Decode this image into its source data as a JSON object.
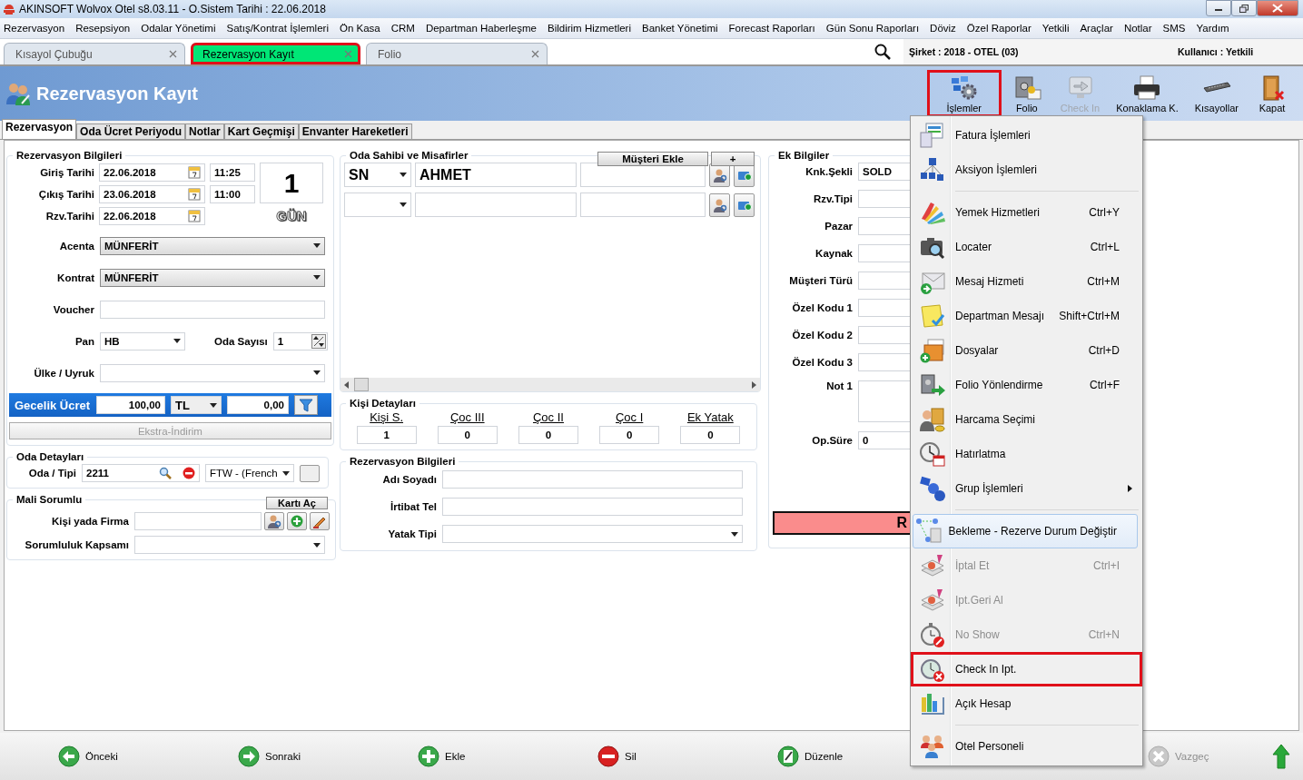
{
  "window": {
    "title": "AKINSOFT Wolvox Otel s8.03.11 - O.Sistem Tarihi : 22.06.2018"
  },
  "menu_bar": [
    "Rezervasyon",
    "Resepsiyon",
    "Odalar Yönetimi",
    "Satış/Kontrat İşlemleri",
    "Ön Kasa",
    "CRM",
    "Departman Haberleşme",
    "Bildirim Hizmetleri",
    "Banket Yönetimi",
    "Forecast Raporları",
    "Gün Sonu Raporları",
    "Döviz",
    "Özel Raporlar",
    "Yetkili",
    "Araçlar",
    "Notlar",
    "SMS",
    "Yardım"
  ],
  "doc_tabs": [
    {
      "label": "Kısayol Çubuğu",
      "selected": false,
      "outlined": false
    },
    {
      "label": "Rezervasyon Kayıt",
      "selected": true,
      "outlined": true
    },
    {
      "label": "Folio",
      "selected": false,
      "outlined": false
    }
  ],
  "company": "Şirket : 2018 - OTEL (03)",
  "user": "Kullanıcı : Yetkili",
  "header": {
    "title": "Rezervasyon Kayıt"
  },
  "toolbar": [
    {
      "label": "İşlemler",
      "disabled": false,
      "outlined": true
    },
    {
      "label": "Folio",
      "disabled": false,
      "outlined": false
    },
    {
      "label": "Check In",
      "disabled": true,
      "outlined": false
    },
    {
      "label": "Konaklama K.",
      "disabled": false,
      "outlined": false
    },
    {
      "label": "Kısayollar",
      "disabled": false,
      "outlined": false
    },
    {
      "label": "Kapat",
      "disabled": false,
      "outlined": false
    }
  ],
  "form_tabs": [
    {
      "label": "Rezervasyon",
      "selected": true
    },
    {
      "label": "Oda Ücret Periyodu",
      "selected": false
    },
    {
      "label": "Notlar",
      "selected": false
    },
    {
      "label": "Kart Geçmişi",
      "selected": false
    },
    {
      "label": "Envanter Hareketleri",
      "selected": false
    }
  ],
  "reservation": {
    "title": "Rezervasyon Bilgileri",
    "dates": [
      {
        "label": "Giriş Tarihi",
        "date": "22.06.2018",
        "time": "11:25"
      },
      {
        "label": "Çıkış Tarihi",
        "date": "23.06.2018",
        "time": "11:00"
      },
      {
        "label": "Rzv.Tarihi",
        "date": "22.06.2018"
      }
    ],
    "nights": "1",
    "nights_unit": "GÜN",
    "agency": {
      "label": "Acenta",
      "value": "MÜNFERİT"
    },
    "contract": {
      "label": "Kontrat",
      "value": "MÜNFERİT"
    },
    "voucher": {
      "label": "Voucher"
    },
    "board": {
      "label": "Pan",
      "value": "HB"
    },
    "room_count": {
      "label": "Oda Sayısı",
      "value": "1"
    },
    "country": {
      "label": "Ülke / Uyruk"
    },
    "rate": {
      "label": "Gecelik Ücret",
      "amount": "100,00",
      "currency": "TL",
      "extra": "0,00"
    },
    "extra_button": {
      "label": "Ekstra-İndirim",
      "disabled": true
    }
  },
  "room_details": {
    "title": "Oda Detayları",
    "label": "Oda / Tipi",
    "room": "2211",
    "type": "FTW - (French"
  },
  "responsible": {
    "title": "Mali Sorumlu",
    "button": "Kartı Aç",
    "person_label": "Kişi yada Firma",
    "scope_label": "Sorumluluk Kapsamı"
  },
  "guests": {
    "title": "Oda Sahibi ve Misafirler",
    "add_button": "Müşteri Ekle",
    "plus_button": "+",
    "rows": [
      {
        "salutation": "SN",
        "name": "AHMET"
      },
      {}
    ]
  },
  "person_details": {
    "title": "Kişi Detayları",
    "counts": [
      {
        "label": "Kişi S.",
        "value": "1"
      },
      {
        "label": "Çoc III",
        "value": "0"
      },
      {
        "label": "Çoc II",
        "value": "0"
      },
      {
        "label": "Çoc I",
        "value": "0"
      },
      {
        "label": "Ek Yatak",
        "value": "0"
      }
    ]
  },
  "contact": {
    "title": "Rezervasyon Bilgileri",
    "fields": [
      {
        "label": "Adı Soyadı",
        "kind": "text"
      },
      {
        "label": "İrtibat Tel",
        "kind": "text"
      },
      {
        "label": "Yatak Tipi",
        "kind": "select"
      }
    ]
  },
  "extra_info": {
    "title": "Ek Bilgiler",
    "fields": [
      {
        "label": "Knk.Şekli",
        "kind": "text",
        "value": "SOLD"
      },
      {
        "label": "Rzv.Tipi",
        "kind": "text"
      },
      {
        "label": "Pazar",
        "kind": "text"
      },
      {
        "label": "Kaynak",
        "kind": "text"
      },
      {
        "label": "Müşteri Türü",
        "kind": "text"
      },
      {
        "label": "Özel Kodu 1",
        "kind": "text"
      },
      {
        "label": "Özel Kodu 2",
        "kind": "text"
      },
      {
        "label": "Özel Kodu 3",
        "kind": "text"
      },
      {
        "label": "Not 1",
        "kind": "memo"
      },
      {
        "label": "Op.Süre",
        "kind": "text",
        "value": "0"
      }
    ],
    "status_banner": "R"
  },
  "context_menu": [
    {
      "kind": "item",
      "label": "Fatura İşlemleri",
      "disabled": false,
      "selected": false,
      "outlined": false,
      "submenu": false
    },
    {
      "kind": "item",
      "label": "Aksiyon İşlemleri",
      "disabled": false,
      "selected": false,
      "outlined": false,
      "submenu": false
    },
    {
      "kind": "separator"
    },
    {
      "kind": "item",
      "label": "Yemek Hizmetleri",
      "shortcut": "Ctrl+Y",
      "disabled": false,
      "selected": false,
      "outlined": false,
      "submenu": false
    },
    {
      "kind": "item",
      "label": "Locater",
      "shortcut": "Ctrl+L",
      "disabled": false,
      "selected": false,
      "outlined": false,
      "submenu": false
    },
    {
      "kind": "item",
      "label": "Mesaj Hizmeti",
      "shortcut": "Ctrl+M",
      "disabled": false,
      "selected": false,
      "outlined": false,
      "submenu": false
    },
    {
      "kind": "item",
      "label": "Departman Mesajı",
      "shortcut": "Shift+Ctrl+M",
      "disabled": false,
      "selected": false,
      "outlined": false,
      "submenu": false
    },
    {
      "kind": "item",
      "label": "Dosyalar",
      "shortcut": "Ctrl+D",
      "disabled": false,
      "selected": false,
      "outlined": false,
      "submenu": false
    },
    {
      "kind": "item",
      "label": "Folio Yönlendirme",
      "shortcut": "Ctrl+F",
      "disabled": false,
      "selected": false,
      "outlined": false,
      "submenu": false
    },
    {
      "kind": "item",
      "label": "Harcama Seçimi",
      "disabled": false,
      "selected": false,
      "outlined": false,
      "submenu": false
    },
    {
      "kind": "item",
      "label": "Hatırlatma",
      "disabled": false,
      "selected": false,
      "outlined": false,
      "submenu": false
    },
    {
      "kind": "item",
      "label": "Grup İşlemleri",
      "disabled": false,
      "selected": false,
      "outlined": false,
      "submenu": true
    },
    {
      "kind": "separator"
    },
    {
      "kind": "item",
      "label": "Bekleme - Rezerve Durum Değiştir",
      "disabled": false,
      "selected": true,
      "outlined": false,
      "submenu": false
    },
    {
      "kind": "item",
      "label": "İptal Et",
      "shortcut": "Ctrl+I",
      "disabled": true,
      "selected": false,
      "outlined": false,
      "submenu": false
    },
    {
      "kind": "item",
      "label": "Ipt.Geri Al",
      "disabled": true,
      "selected": false,
      "outlined": false,
      "submenu": false
    },
    {
      "kind": "item",
      "label": "No Show",
      "shortcut": "Ctrl+N",
      "disabled": true,
      "selected": false,
      "outlined": false,
      "submenu": false
    },
    {
      "kind": "item",
      "label": "Check In Ipt.",
      "disabled": false,
      "selected": false,
      "outlined": true,
      "submenu": false
    },
    {
      "kind": "item",
      "label": "Açık Hesap",
      "disabled": false,
      "selected": false,
      "outlined": false,
      "submenu": false
    },
    {
      "kind": "separator"
    },
    {
      "kind": "item",
      "label": "Otel Personeli",
      "disabled": false,
      "selected": false,
      "outlined": false,
      "submenu": false
    }
  ],
  "bottom_bar": [
    {
      "kind": "previous",
      "label": "Önceki",
      "disabled": false
    },
    {
      "kind": "next",
      "label": "Sonraki",
      "disabled": false
    },
    {
      "kind": "add",
      "label": "Ekle",
      "disabled": false
    },
    {
      "kind": "delete",
      "label": "Sil",
      "disabled": false
    },
    {
      "kind": "edit",
      "label": "Düzenle",
      "disabled": false
    },
    {
      "kind": "cancel",
      "label": "Vazgeç",
      "disabled": true
    },
    {
      "kind": "up",
      "disabled": false
    }
  ]
}
